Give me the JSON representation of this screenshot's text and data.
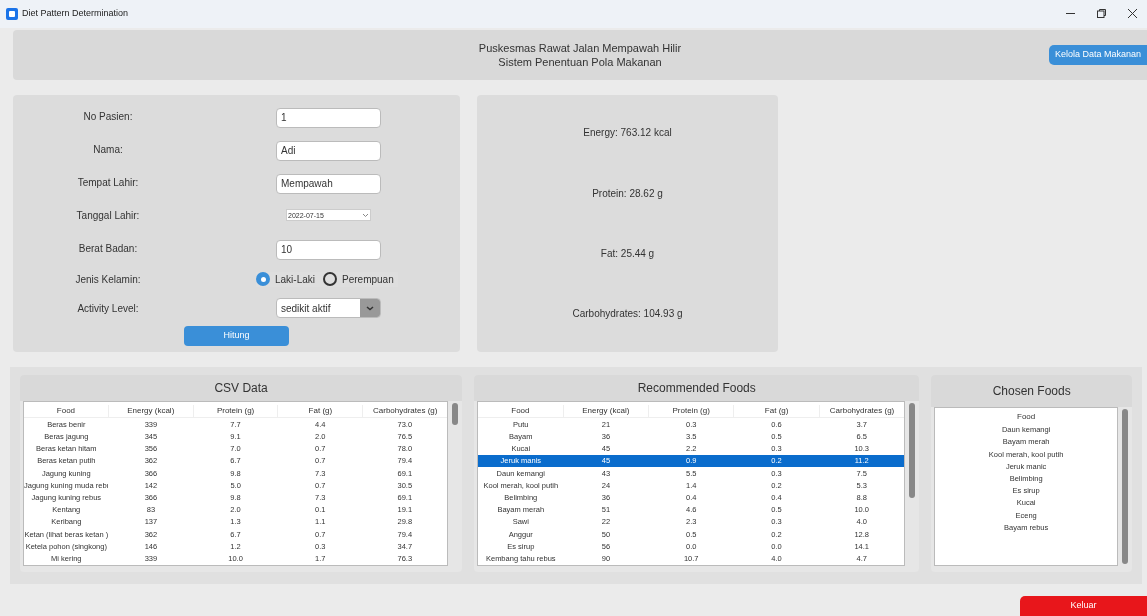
{
  "window": {
    "title": "Diet Pattern Determination"
  },
  "header": {
    "lines": [
      "Puskesmas Rawat Jalan Mempawah Hilir",
      "Sistem Penentuan Pola Makanan"
    ],
    "button": "Kelola Data Makanan"
  },
  "form": {
    "fields": [
      {
        "kind": "text",
        "label": "No Pasien:",
        "value": "1"
      },
      {
        "kind": "text",
        "label": "Nama:",
        "value": "Adi"
      },
      {
        "kind": "text",
        "label": "Tempat Lahir:",
        "value": "Mempawah"
      },
      {
        "kind": "date",
        "label": "Tanggal Lahir:",
        "value": "2022-07-15"
      },
      {
        "kind": "text",
        "label": "Berat Badan:",
        "value": "10"
      },
      {
        "kind": "radio",
        "label": "Jenis Kelamin:",
        "options": [
          {
            "label": "Laki-Laki",
            "selected": true
          },
          {
            "label": "Perempuan",
            "selected": false
          }
        ]
      },
      {
        "kind": "select",
        "label": "Activity Level:",
        "value": "sedikit aktif"
      }
    ],
    "button": "Hitung"
  },
  "results": [
    "Energy: 763.12 kcal",
    "Protein: 28.62 g",
    "Fat: 25.44 g",
    "Carbohydrates: 104.93 g"
  ],
  "csv_data": {
    "title": "CSV Data",
    "columns": [
      "Food",
      "Energy (kcal)",
      "Protein (g)",
      "Fat (g)",
      "Carbohydrates (g)"
    ],
    "rows": [
      {
        "cells": [
          "Beras benir",
          "339",
          "7.7",
          "4.4",
          "73.0"
        ],
        "selected": false
      },
      {
        "cells": [
          "Beras jagung",
          "345",
          "9.1",
          "2.0",
          "76.5"
        ],
        "selected": false
      },
      {
        "cells": [
          "Beras ketan hitam",
          "356",
          "7.0",
          "0.7",
          "78.0"
        ],
        "selected": false
      },
      {
        "cells": [
          "Beras ketan putih",
          "362",
          "6.7",
          "0.7",
          "79.4"
        ],
        "selected": false
      },
      {
        "cells": [
          "Jagung kuning",
          "366",
          "9.8",
          "7.3",
          "69.1"
        ],
        "selected": false
      },
      {
        "cells": [
          "Jagung kuning muda rebı",
          "142",
          "5.0",
          "0.7",
          "30.5"
        ],
        "selected": false
      },
      {
        "cells": [
          "Jagung kuning rebus",
          "366",
          "9.8",
          "7.3",
          "69.1"
        ],
        "selected": false
      },
      {
        "cells": [
          "Kentang",
          "83",
          "2.0",
          "0.1",
          "19.1"
        ],
        "selected": false
      },
      {
        "cells": [
          "Keribang",
          "137",
          "1.3",
          "1.1",
          "29.8"
        ],
        "selected": false
      },
      {
        "cells": [
          "Ketan (lihat beras ketan )",
          "362",
          "6.7",
          "0.7",
          "79.4"
        ],
        "selected": false
      },
      {
        "cells": [
          "Ketela pohon (singkong)",
          "146",
          "1.2",
          "0.3",
          "34.7"
        ],
        "selected": false
      },
      {
        "cells": [
          "Mi kering",
          "339",
          "10.0",
          "1.7",
          "76.3"
        ],
        "selected": false
      }
    ]
  },
  "recommended_foods": {
    "title": "Recommended Foods",
    "columns": [
      "Food",
      "Energy (kcal)",
      "Protein (g)",
      "Fat (g)",
      "Carbohydrates (g)"
    ],
    "rows": [
      {
        "cells": [
          "Putu",
          "21",
          "0.3",
          "0.6",
          "3.7"
        ],
        "selected": false
      },
      {
        "cells": [
          "Bayam",
          "36",
          "3.5",
          "0.5",
          "6.5"
        ],
        "selected": false
      },
      {
        "cells": [
          "Kucai",
          "45",
          "2.2",
          "0.3",
          "10.3"
        ],
        "selected": false
      },
      {
        "cells": [
          "Jeruk manis",
          "45",
          "0.9",
          "0.2",
          "11.2"
        ],
        "selected": true
      },
      {
        "cells": [
          "Daun kemangi",
          "43",
          "5.5",
          "0.3",
          "7.5"
        ],
        "selected": false
      },
      {
        "cells": [
          "Kool merah, kool putih",
          "24",
          "1.4",
          "0.2",
          "5.3"
        ],
        "selected": false
      },
      {
        "cells": [
          "Belimbing",
          "36",
          "0.4",
          "0.4",
          "8.8"
        ],
        "selected": false
      },
      {
        "cells": [
          "Bayam merah",
          "51",
          "4.6",
          "0.5",
          "10.0"
        ],
        "selected": false
      },
      {
        "cells": [
          "Sawi",
          "22",
          "2.3",
          "0.3",
          "4.0"
        ],
        "selected": false
      },
      {
        "cells": [
          "Anggur",
          "50",
          "0.5",
          "0.2",
          "12.8"
        ],
        "selected": false
      },
      {
        "cells": [
          "Es sirup",
          "56",
          "0.0",
          "0.0",
          "14.1"
        ],
        "selected": false
      },
      {
        "cells": [
          "Kembang tahu rebus",
          "90",
          "10.7",
          "4.0",
          "4.7"
        ],
        "selected": false
      }
    ]
  },
  "chosen_foods": {
    "title": "Chosen Foods",
    "column": "Food",
    "items": [
      "Daun kemangi",
      "Bayam merah",
      "Kool merah, kool putih",
      "Jeruk manic",
      "Belimbing",
      "Es sirup",
      "Kucai",
      "Eceng",
      "Bayam rebus"
    ]
  },
  "exit_button": "Keluar"
}
